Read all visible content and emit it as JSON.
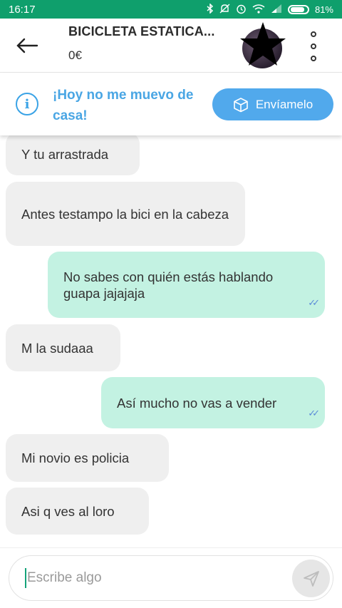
{
  "status_bar": {
    "time": "16:17",
    "battery": "81%",
    "icons": [
      "bluetooth-icon",
      "mute-icon",
      "alarm-icon",
      "wifi-icon",
      "signal-icon",
      "battery-icon"
    ]
  },
  "header": {
    "title": "BICICLETA ESTATICA...",
    "price": "0€",
    "icons": [
      "back-arrow-icon",
      "avatar",
      "more-vertical-icon"
    ]
  },
  "banner": {
    "text": "¡Hoy no me muevo de casa!",
    "button_label": "Envíamelo",
    "accent_color": "#51a9ec"
  },
  "messages": [
    {
      "direction": "incoming",
      "text": "Y tu arrastrada"
    },
    {
      "direction": "incoming",
      "text": "Antes testampo la bici en la cabeza"
    },
    {
      "direction": "outgoing",
      "text": "No sabes con quién estás hablando guapa jajajaja",
      "read": true
    },
    {
      "direction": "incoming",
      "text": "M la sudaaa"
    },
    {
      "direction": "outgoing",
      "text": "Así mucho no vas a vender",
      "read": true
    },
    {
      "direction": "incoming",
      "text": "Mi novio es policia"
    },
    {
      "direction": "incoming",
      "text": "Asi q ves al loro"
    }
  ],
  "composer": {
    "placeholder": "Escribe algo"
  },
  "colors": {
    "status_bar": "#0f9f6c",
    "incoming_bubble": "#efefef",
    "outgoing_bubble": "#c3f2e2",
    "read_ticks": "#5b8bd8"
  }
}
